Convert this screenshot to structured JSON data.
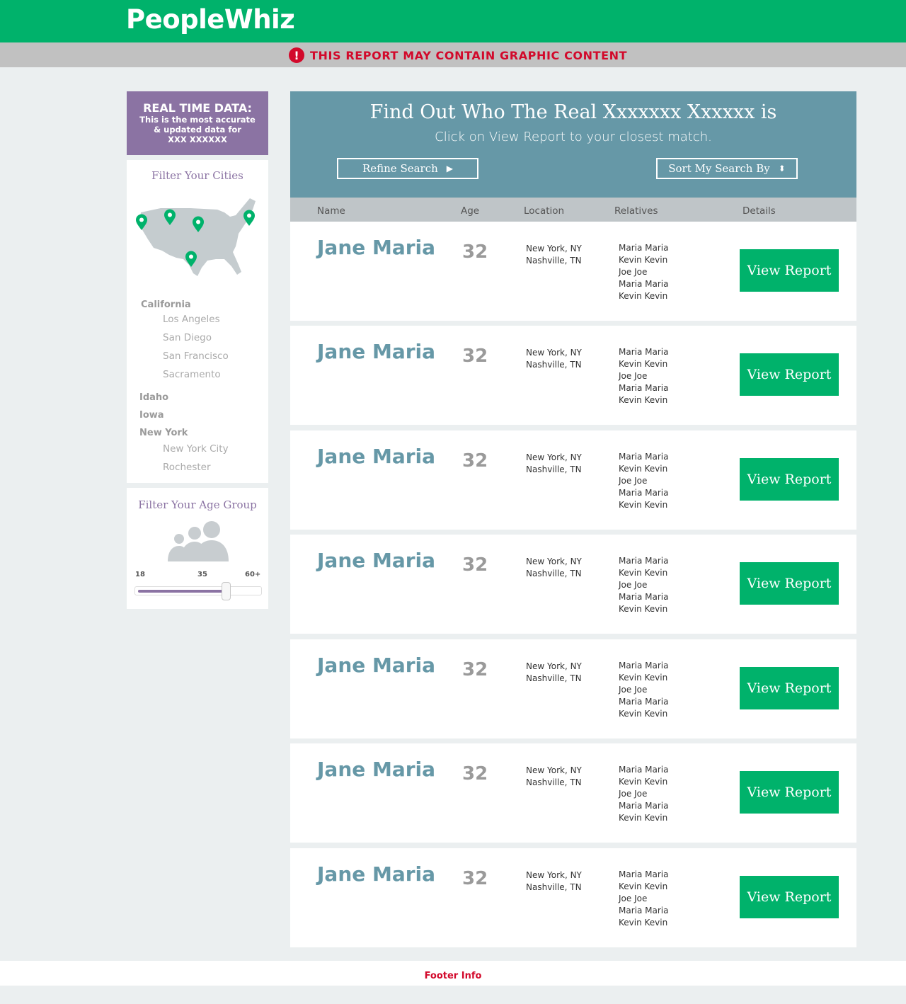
{
  "brand": {
    "name": "PeopleWhiz"
  },
  "warning": {
    "icon": "!",
    "text": "THIS REPORT MAY CONTAIN GRAPHIC CONTENT"
  },
  "realtime": {
    "title": "REAL TIME DATA:",
    "line1": "This is the most accurate",
    "line2": "& updated data for",
    "line3": "XXX XXXXXX"
  },
  "cities": {
    "title": "Filter Your Cities",
    "california": {
      "label": "California",
      "cities": [
        "Los Angeles",
        "San Diego",
        "San Francisco",
        "Sacramento"
      ]
    },
    "idaho": "Idaho",
    "iowa": "Iowa",
    "newyork": {
      "label": "New York",
      "cities": [
        "New York City",
        "Rochester"
      ]
    }
  },
  "age": {
    "title": "Filter Your Age Group",
    "min": "18",
    "mid": "35",
    "max": "60+",
    "slider_fraction": 0.69
  },
  "hero": {
    "title": "Find Out Who The Real Xxxxxxx Xxxxxx is",
    "subtitle": "Click on View Report to your closest match.",
    "refine_label": "Refine Search",
    "refine_glyph": "▶",
    "sort_label": "Sort My Search By",
    "sort_glyph": "⬍"
  },
  "columns": {
    "name": "Name",
    "age": "Age",
    "location": "Location",
    "relatives": "Relatives",
    "details": "Details"
  },
  "results": [
    {
      "name": "Jane Maria",
      "age": "32",
      "loc1": "New York, NY",
      "loc2": "Nashville, TN",
      "relatives": [
        "Maria Maria",
        "Kevin Kevin",
        "Joe Joe",
        "Maria Maria",
        "Kevin Kevin"
      ],
      "button": "View Report"
    },
    {
      "name": "Jane Maria",
      "age": "32",
      "loc1": "New York, NY",
      "loc2": "Nashville, TN",
      "relatives": [
        "Maria Maria",
        "Kevin Kevin",
        "Joe Joe",
        "Maria Maria",
        "Kevin Kevin"
      ],
      "button": "View Report"
    },
    {
      "name": "Jane Maria",
      "age": "32",
      "loc1": "New York, NY",
      "loc2": "Nashville, TN",
      "relatives": [
        "Maria Maria",
        "Kevin Kevin",
        "Joe Joe",
        "Maria Maria",
        "Kevin Kevin"
      ],
      "button": "View Report"
    },
    {
      "name": "Jane Maria",
      "age": "32",
      "loc1": "New York, NY",
      "loc2": "Nashville, TN",
      "relatives": [
        "Maria Maria",
        "Kevin Kevin",
        "Joe Joe",
        "Maria Maria",
        "Kevin Kevin"
      ],
      "button": "View Report"
    },
    {
      "name": "Jane Maria",
      "age": "32",
      "loc1": "New York, NY",
      "loc2": "Nashville, TN",
      "relatives": [
        "Maria Maria",
        "Kevin Kevin",
        "Joe Joe",
        "Maria Maria",
        "Kevin Kevin"
      ],
      "button": "View Report"
    },
    {
      "name": "Jane Maria",
      "age": "32",
      "loc1": "New York, NY",
      "loc2": "Nashville, TN",
      "relatives": [
        "Maria Maria",
        "Kevin Kevin",
        "Joe Joe",
        "Maria Maria",
        "Kevin Kevin"
      ],
      "button": "View Report"
    },
    {
      "name": "Jane Maria",
      "age": "32",
      "loc1": "New York, NY",
      "loc2": "Nashville, TN",
      "relatives": [
        "Maria Maria",
        "Kevin Kevin",
        "Joe Joe",
        "Maria Maria",
        "Kevin Kevin"
      ],
      "button": "View Report"
    }
  ],
  "footer": {
    "text": "Footer Info"
  },
  "colors": {
    "brand_green": "#00b26b",
    "accent_purple": "#8b73a3",
    "hero_blue": "#6698a7",
    "alert_red": "#d2092b"
  }
}
